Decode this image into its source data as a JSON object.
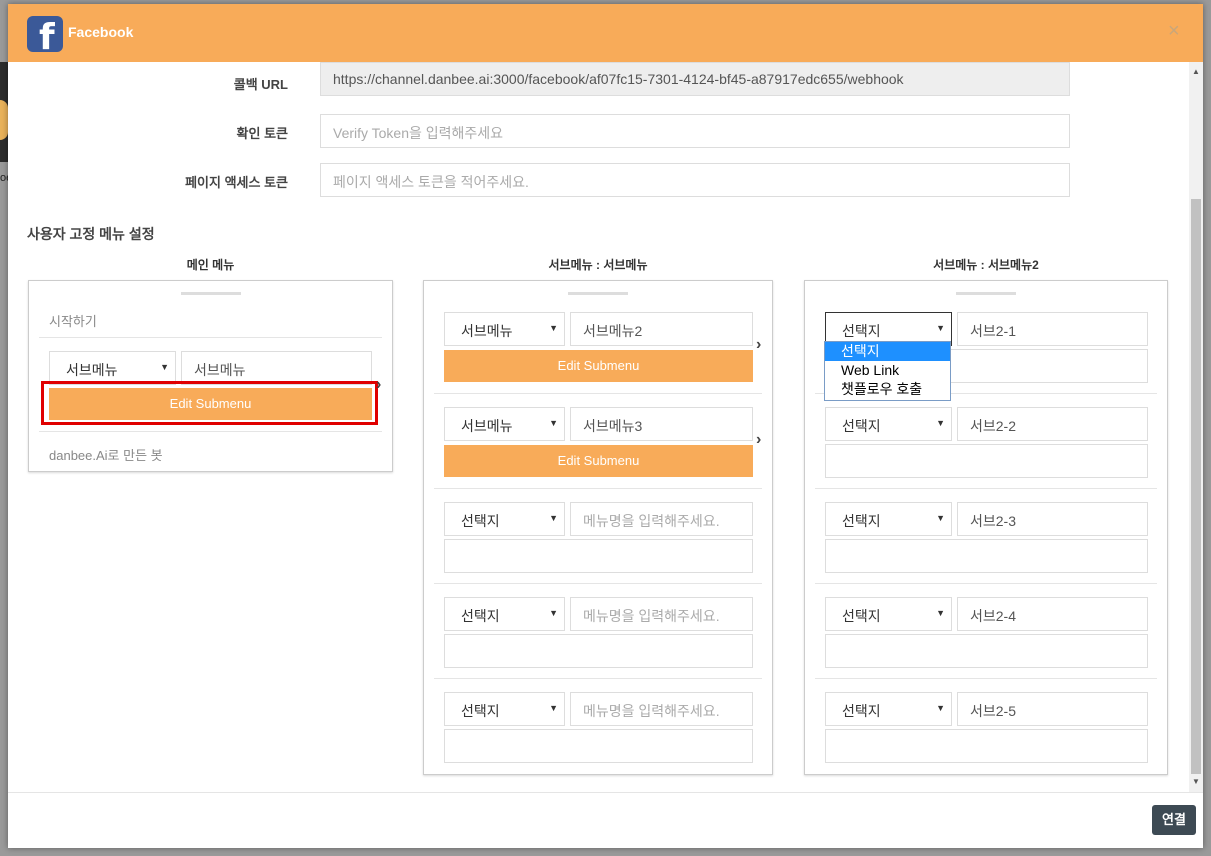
{
  "header": {
    "title": "Facebook",
    "close_label": "×",
    "logo_letter": "f"
  },
  "background": {
    "peek_text": "oe"
  },
  "form": {
    "callback": {
      "label": "콜백 URL",
      "value": "https://channel.danbee.ai:3000/facebook/af07fc15-7301-4124-bf45-a87917edc655/webhook"
    },
    "verify": {
      "label": "확인 토큰",
      "placeholder": "Verify Token을 입력해주세요"
    },
    "page_token": {
      "label": "페이지 액세스 토큰",
      "placeholder": "페이지 액세스 토큰을 적어주세요."
    }
  },
  "menu_section": {
    "title": "사용자 고정 메뉴 설정"
  },
  "main_menu": {
    "title": "메인 메뉴",
    "start_item": "시작하기",
    "row": {
      "select": "서브메뉴",
      "name": "서브메뉴",
      "edit_label": "Edit Submenu"
    },
    "footer_item": "danbee.Ai로 만든 봇"
  },
  "submenu1": {
    "title": "서브메뉴 : 서브메뉴",
    "rows": [
      {
        "select": "서브메뉴",
        "name": "서브메뉴2",
        "edit_label": "Edit Submenu"
      },
      {
        "select": "서브메뉴",
        "name": "서브메뉴3",
        "edit_label": "Edit Submenu"
      },
      {
        "select": "선택지",
        "placeholder": "메뉴명을 입력해주세요."
      },
      {
        "select": "선택지",
        "placeholder": "메뉴명을 입력해주세요."
      },
      {
        "select": "선택지",
        "placeholder": "메뉴명을 입력해주세요."
      }
    ]
  },
  "submenu2": {
    "title": "서브메뉴 : 서브메뉴2",
    "rows": [
      {
        "select": "선택지",
        "name": "서브2-1"
      },
      {
        "select": "선택지",
        "name": "서브2-2"
      },
      {
        "select": "선택지",
        "name": "서브2-3"
      },
      {
        "select": "선택지",
        "name": "서브2-4"
      },
      {
        "select": "선택지",
        "name": "서브2-5"
      }
    ],
    "dropdown_options": [
      "선택지",
      "Web Link",
      "챗플로우 호출"
    ]
  },
  "footer": {
    "connect_label": "연결"
  },
  "colors": {
    "accent": "#f8ab59",
    "highlight": "#e00000",
    "button_dark": "#3d4a54",
    "option_selected": "#1e90ff"
  }
}
